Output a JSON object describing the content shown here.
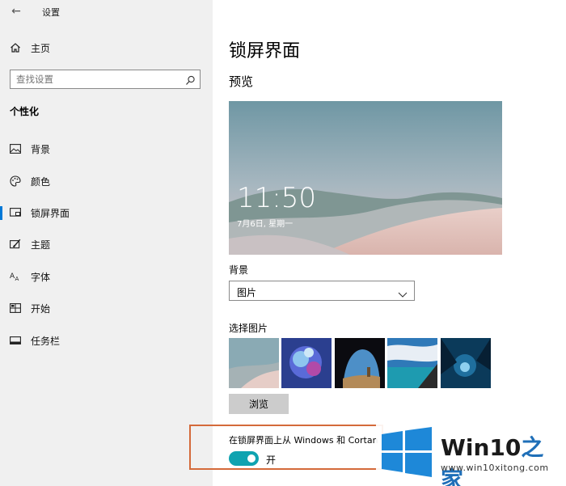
{
  "window": {
    "title": "设置",
    "back_glyph": "←"
  },
  "sidebar": {
    "home_label": "主页",
    "search_placeholder": "查找设置",
    "section_title": "个性化",
    "items": [
      {
        "label": "背景",
        "icon": "picture-icon"
      },
      {
        "label": "颜色",
        "icon": "palette-icon"
      },
      {
        "label": "锁屏界面",
        "icon": "lock-screen-icon",
        "active": true
      },
      {
        "label": "主题",
        "icon": "brush-icon"
      },
      {
        "label": "字体",
        "icon": "font-icon"
      },
      {
        "label": "开始",
        "icon": "start-grid-icon"
      },
      {
        "label": "任务栏",
        "icon": "taskbar-icon"
      }
    ]
  },
  "main": {
    "page_title": "锁屏界面",
    "preview_heading": "预览",
    "preview_time": "11:50",
    "preview_date": "7月6日, 星期一",
    "background_label": "背景",
    "background_value": "图片",
    "choose_picture_label": "选择图片",
    "browse_label": "浏览",
    "tips_label": "在锁屏界面上从 Windows 和 Cortan",
    "toggle_state_label": "开",
    "toggle_on": true
  },
  "watermark": {
    "title_prefix": "Win10",
    "title_suffix": "之家",
    "url": "www.win10xitong.com"
  },
  "colors": {
    "accent": "#0078d7",
    "toggle": "#0fa3b0",
    "highlight_box": "#d46a3a",
    "sidebar_bg": "#f0f0f0"
  }
}
